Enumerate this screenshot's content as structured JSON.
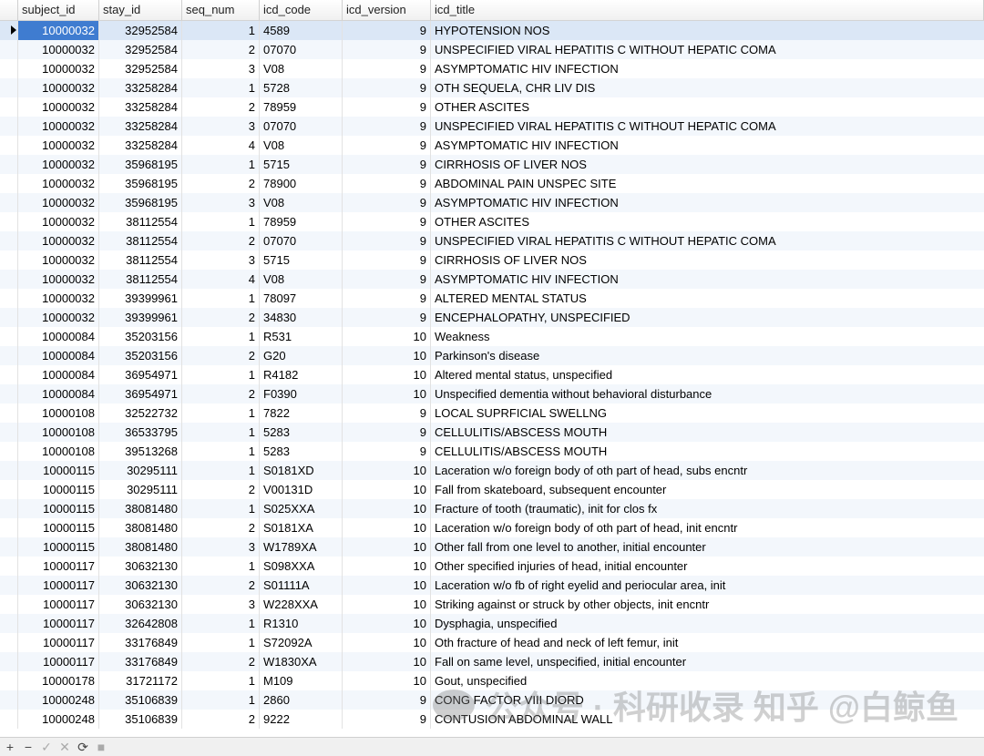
{
  "columns": [
    "subject_id",
    "stay_id",
    "seq_num",
    "icd_code",
    "icd_version",
    "icd_title"
  ],
  "rows": [
    [
      "10000032",
      "32952584",
      "1",
      "4589",
      "9",
      "HYPOTENSION NOS"
    ],
    [
      "10000032",
      "32952584",
      "2",
      "07070",
      "9",
      "UNSPECIFIED VIRAL HEPATITIS C WITHOUT HEPATIC COMA"
    ],
    [
      "10000032",
      "32952584",
      "3",
      "V08",
      "9",
      "ASYMPTOMATIC HIV INFECTION"
    ],
    [
      "10000032",
      "33258284",
      "1",
      "5728",
      "9",
      "OTH SEQUELA, CHR LIV DIS"
    ],
    [
      "10000032",
      "33258284",
      "2",
      "78959",
      "9",
      "OTHER ASCITES"
    ],
    [
      "10000032",
      "33258284",
      "3",
      "07070",
      "9",
      "UNSPECIFIED VIRAL HEPATITIS C WITHOUT HEPATIC COMA"
    ],
    [
      "10000032",
      "33258284",
      "4",
      "V08",
      "9",
      "ASYMPTOMATIC HIV INFECTION"
    ],
    [
      "10000032",
      "35968195",
      "1",
      "5715",
      "9",
      "CIRRHOSIS OF LIVER NOS"
    ],
    [
      "10000032",
      "35968195",
      "2",
      "78900",
      "9",
      "ABDOMINAL PAIN UNSPEC SITE"
    ],
    [
      "10000032",
      "35968195",
      "3",
      "V08",
      "9",
      "ASYMPTOMATIC HIV INFECTION"
    ],
    [
      "10000032",
      "38112554",
      "1",
      "78959",
      "9",
      "OTHER ASCITES"
    ],
    [
      "10000032",
      "38112554",
      "2",
      "07070",
      "9",
      "UNSPECIFIED VIRAL HEPATITIS C WITHOUT HEPATIC COMA"
    ],
    [
      "10000032",
      "38112554",
      "3",
      "5715",
      "9",
      "CIRRHOSIS OF LIVER NOS"
    ],
    [
      "10000032",
      "38112554",
      "4",
      "V08",
      "9",
      "ASYMPTOMATIC HIV INFECTION"
    ],
    [
      "10000032",
      "39399961",
      "1",
      "78097",
      "9",
      "ALTERED MENTAL STATUS"
    ],
    [
      "10000032",
      "39399961",
      "2",
      "34830",
      "9",
      "ENCEPHALOPATHY, UNSPECIFIED"
    ],
    [
      "10000084",
      "35203156",
      "1",
      "R531",
      "10",
      "Weakness"
    ],
    [
      "10000084",
      "35203156",
      "2",
      "G20",
      "10",
      "Parkinson's disease"
    ],
    [
      "10000084",
      "36954971",
      "1",
      "R4182",
      "10",
      "Altered mental status, unspecified"
    ],
    [
      "10000084",
      "36954971",
      "2",
      "F0390",
      "10",
      "Unspecified dementia without behavioral disturbance"
    ],
    [
      "10000108",
      "32522732",
      "1",
      "7822",
      "9",
      "LOCAL SUPRFICIAL SWELLNG"
    ],
    [
      "10000108",
      "36533795",
      "1",
      "5283",
      "9",
      "CELLULITIS/ABSCESS MOUTH"
    ],
    [
      "10000108",
      "39513268",
      "1",
      "5283",
      "9",
      "CELLULITIS/ABSCESS MOUTH"
    ],
    [
      "10000115",
      "30295111",
      "1",
      "S0181XD",
      "10",
      "Laceration w/o foreign body of oth part of head, subs encntr"
    ],
    [
      "10000115",
      "30295111",
      "2",
      "V00131D",
      "10",
      "Fall from skateboard, subsequent encounter"
    ],
    [
      "10000115",
      "38081480",
      "1",
      "S025XXA",
      "10",
      "Fracture of tooth (traumatic), init for clos fx"
    ],
    [
      "10000115",
      "38081480",
      "2",
      "S0181XA",
      "10",
      "Laceration w/o foreign body of oth part of head, init encntr"
    ],
    [
      "10000115",
      "38081480",
      "3",
      "W1789XA",
      "10",
      "Other fall from one level to another, initial encounter"
    ],
    [
      "10000117",
      "30632130",
      "1",
      "S098XXA",
      "10",
      "Other specified injuries of head, initial encounter"
    ],
    [
      "10000117",
      "30632130",
      "2",
      "S01111A",
      "10",
      "Laceration w/o fb of right eyelid and periocular area, init"
    ],
    [
      "10000117",
      "30632130",
      "3",
      "W228XXA",
      "10",
      "Striking against or struck by other objects, init encntr"
    ],
    [
      "10000117",
      "32642808",
      "1",
      "R1310",
      "10",
      "Dysphagia, unspecified"
    ],
    [
      "10000117",
      "33176849",
      "1",
      "S72092A",
      "10",
      "Oth fracture of head and neck of left femur, init"
    ],
    [
      "10000117",
      "33176849",
      "2",
      "W1830XA",
      "10",
      "Fall on same level, unspecified, initial encounter"
    ],
    [
      "10000178",
      "31721172",
      "1",
      "M109",
      "10",
      "Gout, unspecified"
    ],
    [
      "10000248",
      "35106839",
      "1",
      "2860",
      "9",
      "CONG FACTOR VIII DIORD"
    ],
    [
      "10000248",
      "35106839",
      "2",
      "9222",
      "9",
      "CONTUSION ABDOMINAL WALL"
    ]
  ],
  "selected_row": 0,
  "footer_buttons": [
    "+",
    "−",
    "✓",
    "✕",
    "⟳",
    "■"
  ],
  "watermark": "公众号 · 科研收录    知乎 @白鲸鱼",
  "colors": {
    "selected": "#3f7cd0",
    "alt_row": "#f3f7fc"
  }
}
